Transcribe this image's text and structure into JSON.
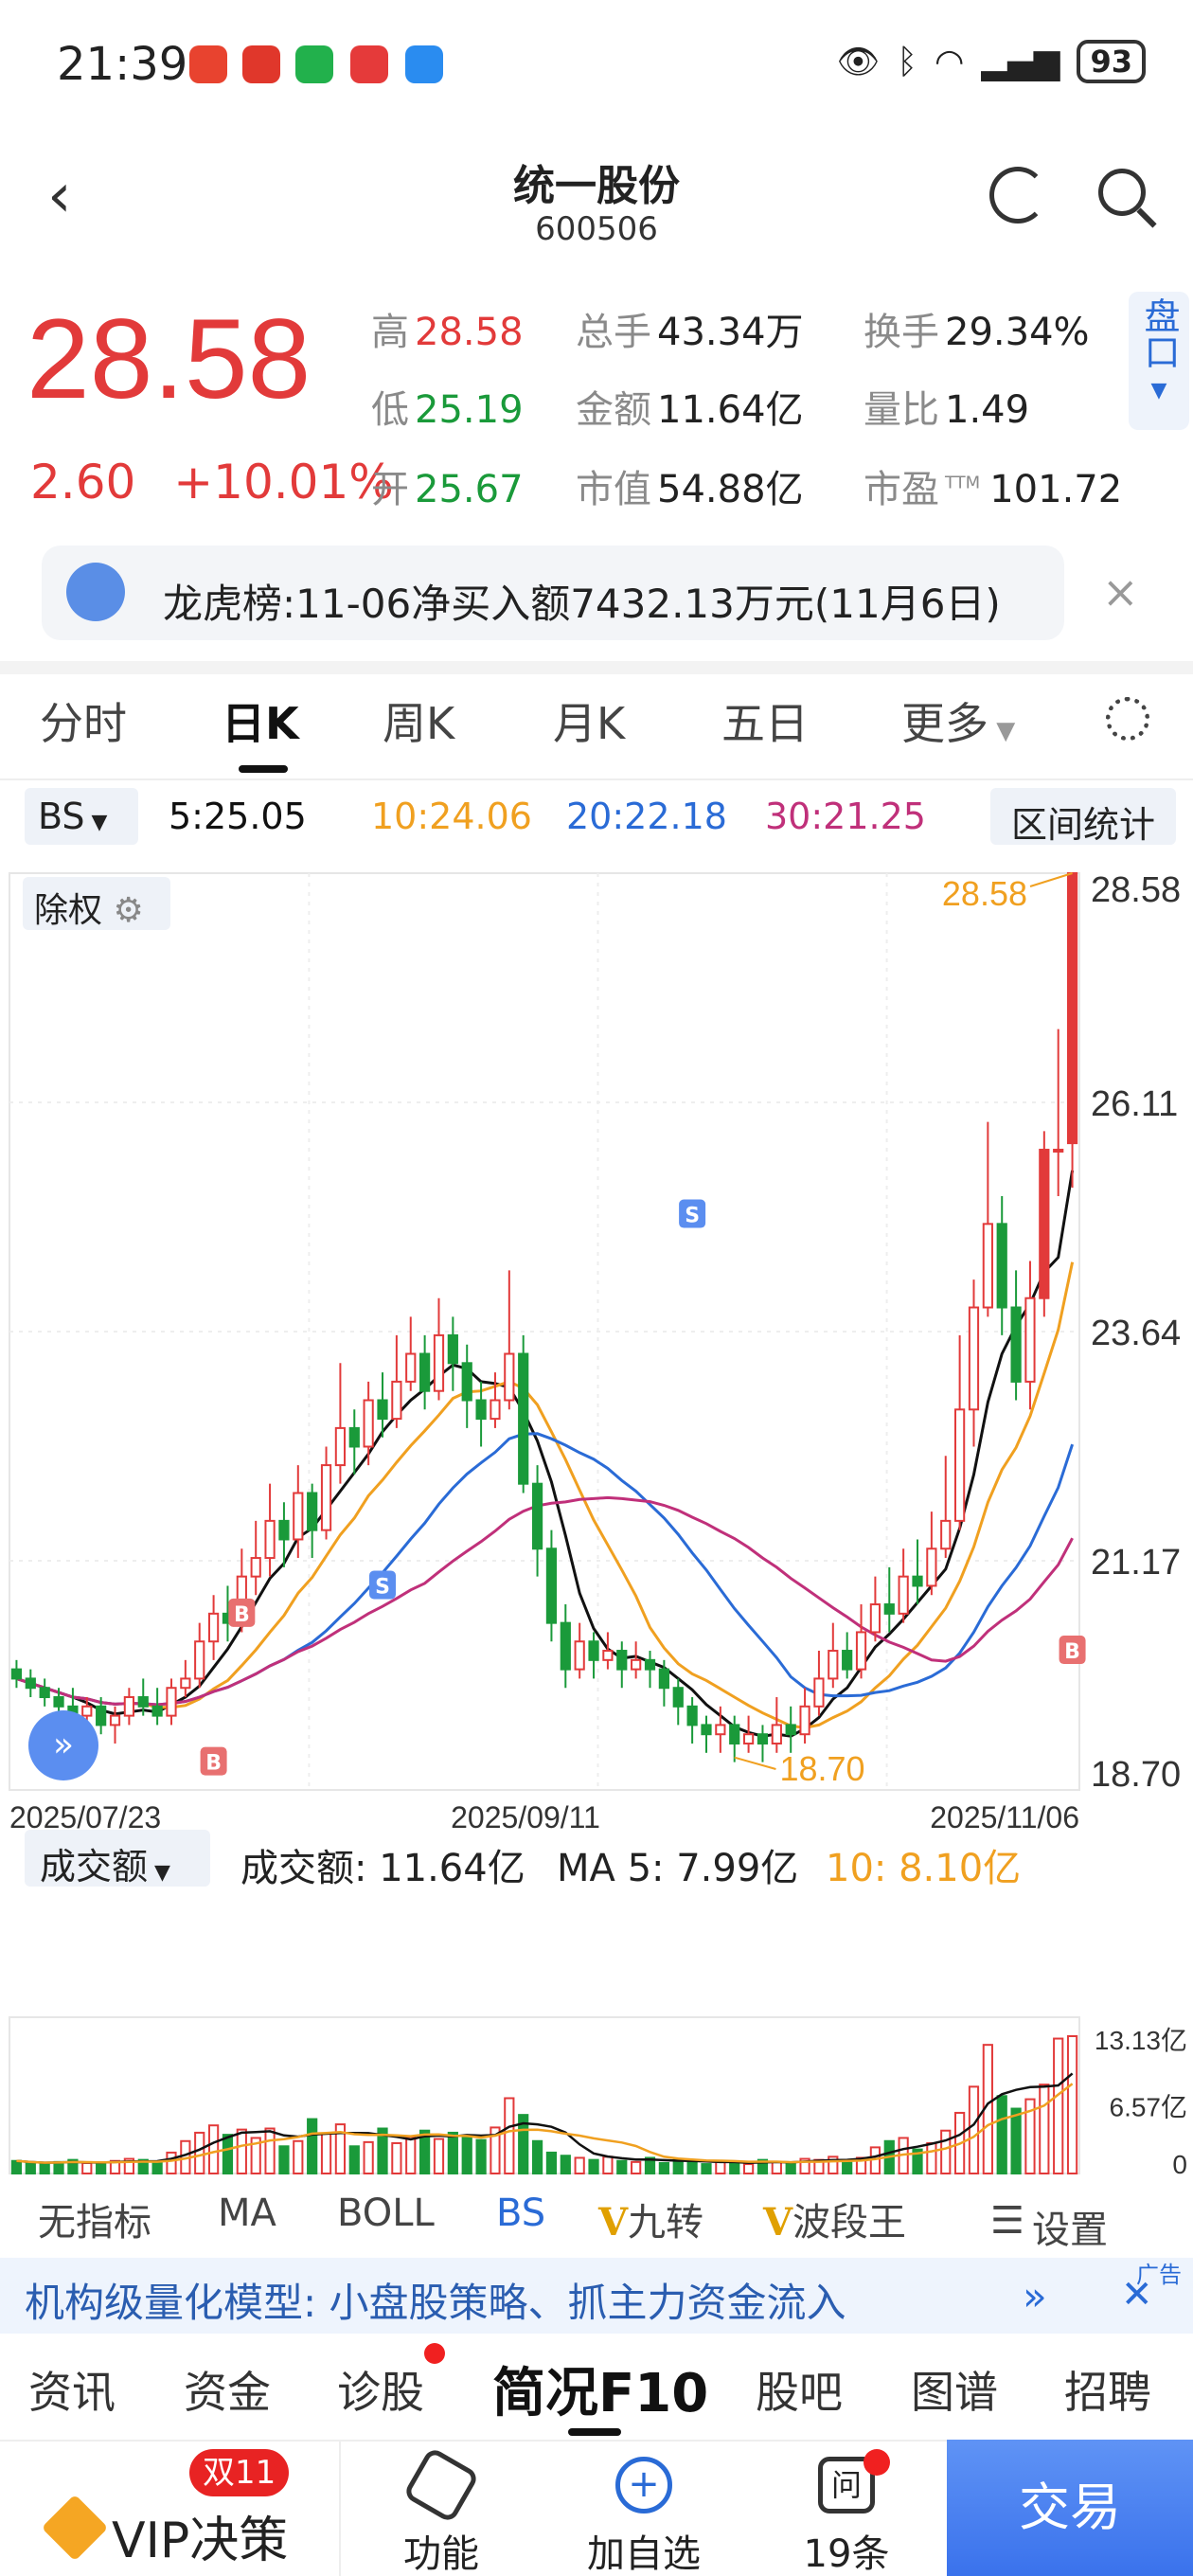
{
  "status_bar": {
    "time": "21:39",
    "battery": "93"
  },
  "header": {
    "title": "统一股份",
    "code": "600506"
  },
  "quote": {
    "price": "28.58",
    "change": "2.60",
    "change_pct": "+10.01%",
    "high_label": "高",
    "high": "28.58",
    "low_label": "低",
    "low": "25.19",
    "open_label": "开",
    "open": "25.67",
    "volume_label": "总手",
    "volume": "43.34万",
    "amount_label": "金额",
    "amount": "11.64亿",
    "mktcap_label": "市值",
    "mktcap": "54.88亿",
    "turnover_label": "换手",
    "turnover": "29.34%",
    "vol_ratio_label": "量比",
    "vol_ratio": "1.49",
    "pe_label": "市盈",
    "pe_sup": "TTM",
    "pe": "101.72",
    "pankou": "盘口"
  },
  "banner": {
    "text": "龙虎榜:11-06净买入额7432.13万元(11月6日)"
  },
  "tabs": [
    "分时",
    "日K",
    "周K",
    "月K",
    "五日",
    "更多"
  ],
  "ma_row": {
    "selector": "BS",
    "ma5": "5:25.05",
    "ma10": "10:24.06",
    "ma20": "20:22.18",
    "ma30": "30:21.25",
    "range_button": "区间统计"
  },
  "chart_controls": {
    "fuquan": "除权"
  },
  "colors": {
    "up": "#e23a3a",
    "down": "#1a9a3a",
    "ma5": "#111111",
    "ma10": "#f0a020",
    "ma20": "#2a6bd6",
    "ma30": "#c0307a",
    "accent": "#2a6bd6"
  },
  "chart_data": {
    "type": "candlestick",
    "y_ticks": [
      "28.58",
      "26.11",
      "23.64",
      "21.17",
      "18.70"
    ],
    "ylim": [
      18.7,
      28.58
    ],
    "x_ticks": [
      "2025/07/23",
      "2025/09/11",
      "2025/11/06"
    ],
    "high_label": "28.58",
    "low_label": "18.70",
    "markers": [
      "S",
      "B",
      "S",
      "B",
      "B"
    ],
    "candles": [
      [
        20.0,
        19.9,
        20.1,
        19.8
      ],
      [
        19.9,
        19.8,
        20.0,
        19.7
      ],
      [
        19.8,
        19.7,
        19.9,
        19.6
      ],
      [
        19.7,
        19.6,
        19.8,
        19.5
      ],
      [
        19.6,
        19.5,
        19.8,
        19.4
      ],
      [
        19.5,
        19.6,
        19.7,
        19.3
      ],
      [
        19.6,
        19.4,
        19.7,
        19.3
      ],
      [
        19.4,
        19.5,
        19.6,
        19.2
      ],
      [
        19.5,
        19.7,
        19.8,
        19.4
      ],
      [
        19.7,
        19.6,
        19.9,
        19.5
      ],
      [
        19.6,
        19.5,
        19.8,
        19.4
      ],
      [
        19.5,
        19.8,
        19.9,
        19.4
      ],
      [
        19.8,
        19.9,
        20.1,
        19.7
      ],
      [
        19.9,
        20.3,
        20.5,
        19.8
      ],
      [
        20.3,
        20.6,
        20.8,
        20.1
      ],
      [
        20.6,
        20.5,
        20.9,
        20.3
      ],
      [
        20.5,
        21.0,
        21.3,
        20.4
      ],
      [
        21.0,
        21.2,
        21.6,
        20.8
      ],
      [
        21.2,
        21.6,
        22.0,
        21.0
      ],
      [
        21.6,
        21.4,
        21.8,
        21.1
      ],
      [
        21.4,
        21.9,
        22.2,
        21.2
      ],
      [
        21.9,
        21.5,
        22.0,
        21.2
      ],
      [
        21.5,
        22.2,
        22.4,
        21.4
      ],
      [
        22.2,
        22.6,
        23.3,
        22.0
      ],
      [
        22.6,
        22.4,
        22.8,
        22.1
      ],
      [
        22.4,
        22.9,
        23.1,
        22.2
      ],
      [
        22.9,
        22.7,
        23.2,
        22.5
      ],
      [
        22.7,
        23.1,
        23.6,
        22.6
      ],
      [
        23.1,
        23.4,
        23.8,
        23.0
      ],
      [
        23.4,
        23.0,
        23.6,
        22.8
      ],
      [
        23.0,
        23.6,
        24.0,
        22.9
      ],
      [
        23.6,
        23.3,
        23.8,
        23.0
      ],
      [
        23.3,
        22.9,
        23.5,
        22.6
      ],
      [
        22.9,
        22.7,
        23.1,
        22.4
      ],
      [
        22.7,
        22.9,
        23.2,
        22.6
      ],
      [
        22.9,
        23.4,
        24.3,
        22.8
      ],
      [
        23.4,
        22.0,
        23.6,
        21.9
      ],
      [
        22.0,
        21.3,
        22.2,
        21.0
      ],
      [
        21.3,
        20.5,
        21.5,
        20.3
      ],
      [
        20.5,
        20.0,
        20.7,
        19.8
      ],
      [
        20.0,
        20.3,
        20.5,
        19.9
      ],
      [
        20.3,
        20.1,
        20.4,
        19.9
      ],
      [
        20.1,
        20.2,
        20.4,
        20.0
      ],
      [
        20.2,
        20.0,
        20.3,
        19.8
      ],
      [
        20.0,
        20.1,
        20.3,
        19.9
      ],
      [
        20.1,
        20.0,
        20.2,
        19.8
      ],
      [
        20.0,
        19.8,
        20.1,
        19.6
      ],
      [
        19.8,
        19.6,
        19.9,
        19.4
      ],
      [
        19.6,
        19.4,
        19.7,
        19.2
      ],
      [
        19.4,
        19.3,
        19.5,
        19.1
      ],
      [
        19.3,
        19.4,
        19.6,
        19.1
      ],
      [
        19.4,
        19.2,
        19.5,
        19.0
      ],
      [
        19.2,
        19.3,
        19.5,
        19.1
      ],
      [
        19.3,
        19.2,
        19.4,
        19.0
      ],
      [
        19.2,
        19.4,
        19.7,
        19.1
      ],
      [
        19.4,
        19.3,
        19.6,
        19.1
      ],
      [
        19.3,
        19.6,
        19.8,
        19.2
      ],
      [
        19.6,
        19.9,
        20.2,
        19.5
      ],
      [
        19.9,
        20.2,
        20.5,
        19.8
      ],
      [
        20.2,
        20.0,
        20.4,
        19.9
      ],
      [
        20.0,
        20.4,
        20.7,
        19.9
      ],
      [
        20.4,
        20.7,
        21.0,
        20.3
      ],
      [
        20.7,
        20.6,
        21.1,
        20.4
      ],
      [
        20.6,
        21.0,
        21.3,
        20.5
      ],
      [
        21.0,
        20.9,
        21.4,
        20.7
      ],
      [
        20.9,
        21.3,
        21.7,
        20.8
      ],
      [
        21.3,
        21.6,
        22.3,
        21.2
      ],
      [
        21.6,
        22.8,
        23.6,
        21.5
      ],
      [
        22.8,
        23.9,
        24.2,
        22.4
      ],
      [
        23.9,
        24.8,
        25.9,
        23.8
      ],
      [
        24.8,
        23.9,
        25.1,
        23.6
      ],
      [
        23.9,
        23.1,
        24.3,
        22.9
      ],
      [
        23.1,
        24.0,
        24.4,
        22.8
      ],
      [
        24.0,
        25.6,
        25.8,
        23.8
      ],
      [
        25.6,
        25.6,
        26.9,
        25.1
      ],
      [
        25.67,
        28.58,
        28.58,
        25.19
      ]
    ],
    "ma5_last": 25.05,
    "ma10_last": 24.06,
    "ma20_last": 22.18,
    "ma30_last": 21.25
  },
  "volume": {
    "selector": "成交额",
    "amount_text": "成交额: 11.64亿",
    "ma5_text": "MA 5: 7.99亿",
    "ma10_text": "10: 8.10亿",
    "axis": [
      "13.13亿",
      "6.57亿",
      "0"
    ],
    "max": 13.13,
    "bars": [
      1.2,
      1.0,
      0.9,
      1.1,
      1.3,
      1.0,
      0.9,
      1.2,
      1.4,
      1.3,
      1.1,
      2.0,
      3.1,
      3.9,
      4.6,
      3.7,
      4.2,
      3.4,
      4.3,
      2.6,
      3.1,
      5.2,
      3.8,
      4.7,
      2.6,
      3.0,
      4.3,
      2.9,
      3.5,
      4.1,
      3.3,
      3.9,
      3.6,
      3.2,
      4.4,
      7.2,
      5.6,
      3.1,
      2.0,
      1.7,
      1.5,
      1.3,
      1.6,
      1.2,
      1.1,
      1.5,
      1.0,
      1.3,
      1.1,
      0.9,
      1.2,
      1.0,
      0.9,
      1.3,
      1.1,
      1.0,
      1.4,
      1.3,
      1.6,
      1.2,
      1.5,
      2.5,
      3.1,
      3.4,
      2.3,
      2.9,
      4.1,
      5.8,
      8.3,
      12.3,
      7.4,
      6.2,
      7.1,
      8.5,
      12.9,
      13.13
    ]
  },
  "indicators": [
    "无指标",
    "MA",
    "BOLL",
    "BS",
    "九转",
    "波段王",
    "设置"
  ],
  "ad": {
    "text": "机构级量化模型: 小盘股策略、抓主力资金流入",
    "tag": "广告"
  },
  "sub_tabs": [
    "资讯",
    "资金",
    "诊股",
    "简况F10",
    "股吧",
    "图谱",
    "招聘"
  ],
  "bottom_bar": {
    "vip_badge": "双11",
    "vip_label": "VIP决策",
    "func_label": "功能",
    "add_label": "加自选",
    "wen_label": "19条",
    "trade_label": "交易"
  }
}
